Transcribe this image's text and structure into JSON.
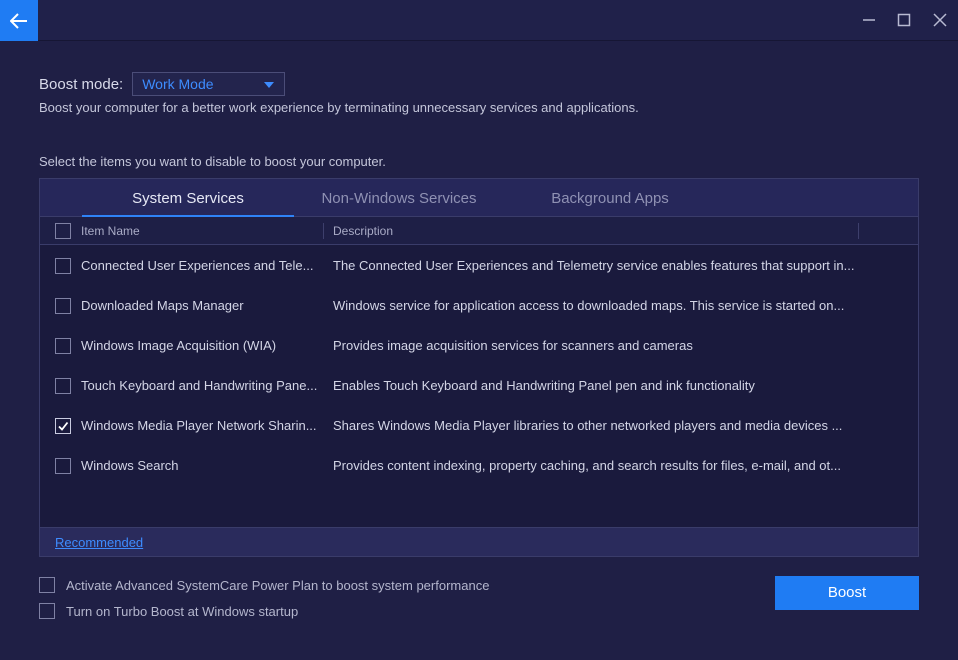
{
  "window": {
    "back_icon": "arrow-left-icon",
    "minimize_icon": "minimize-icon",
    "maximize_icon": "maximize-icon",
    "close_icon": "close-icon",
    "accent": "#1f7cf3"
  },
  "boost_mode": {
    "label": "Boost mode:",
    "selected": "Work Mode",
    "description": "Boost your computer for a better work experience by terminating unnecessary services and applications."
  },
  "prompt": "Select the items you want to disable to boost your computer.",
  "tabs": [
    {
      "label": "System Services",
      "active": true
    },
    {
      "label": "Non-Windows Services",
      "active": false
    },
    {
      "label": "Background Apps",
      "active": false
    }
  ],
  "table": {
    "headers": {
      "name": "Item Name",
      "description": "Description"
    },
    "rows": [
      {
        "name": "Connected User Experiences and Tele...",
        "description": "The Connected User Experiences and Telemetry service enables features that support in...",
        "checked": false
      },
      {
        "name": "Downloaded Maps Manager",
        "description": "Windows service for application access to downloaded maps. This service is started on...",
        "checked": false
      },
      {
        "name": "Windows Image Acquisition (WIA)",
        "description": "Provides image acquisition services for scanners and cameras",
        "checked": false
      },
      {
        "name": "Touch Keyboard and Handwriting Pane...",
        "description": "Enables Touch Keyboard and Handwriting Panel pen and ink functionality",
        "checked": false
      },
      {
        "name": "Windows Media Player Network Sharin...",
        "description": "Shares Windows Media Player libraries to other networked players and media devices ...",
        "checked": true
      },
      {
        "name": "Windows Search",
        "description": "Provides content indexing, property caching, and search results for files, e-mail, and ot...",
        "checked": false
      }
    ]
  },
  "footer_link": "Recommended",
  "options": [
    {
      "label": "Activate Advanced SystemCare Power Plan to boost system performance",
      "checked": false
    },
    {
      "label": "Turn on Turbo Boost at Windows startup",
      "checked": false
    }
  ],
  "boost_button": "Boost"
}
